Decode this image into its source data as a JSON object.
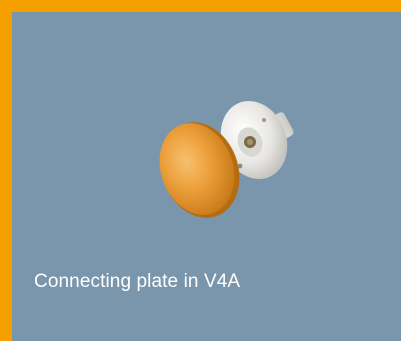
{
  "tile": {
    "caption": "Connecting plate in V4A",
    "image_alt": "product-image-connecting-plate",
    "accent_color": "#f5a000",
    "background_color": "#7a96ac"
  }
}
